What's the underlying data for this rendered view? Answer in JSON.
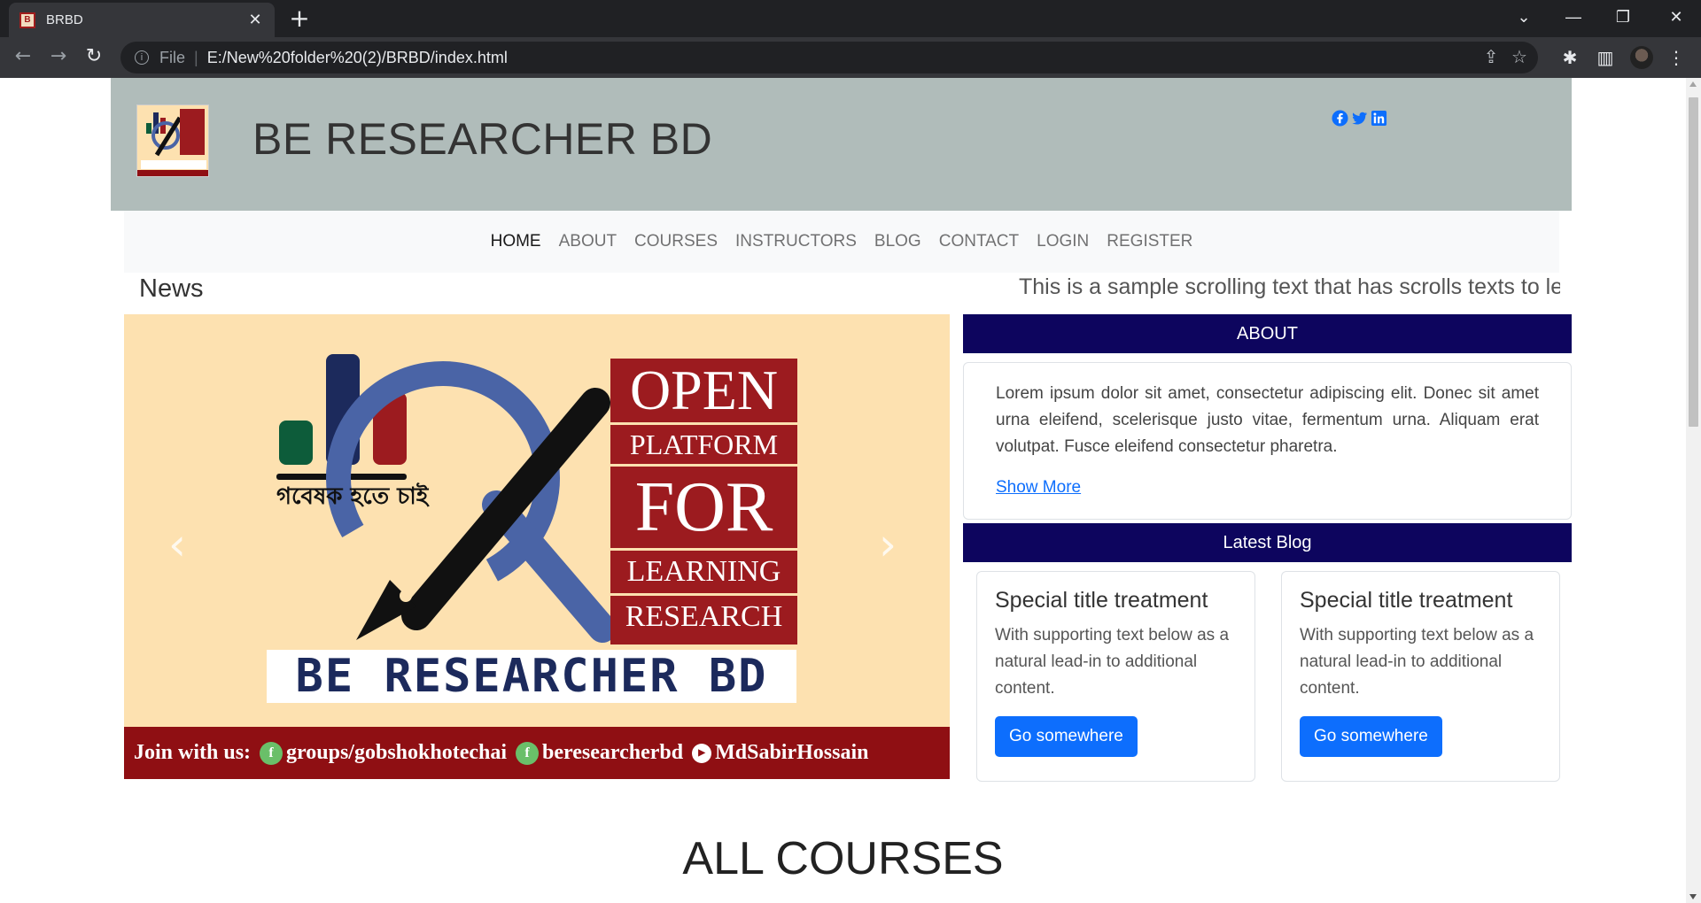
{
  "browser": {
    "tab_title": "BRBD",
    "tab_close": "✕",
    "new_tab": "+",
    "scheme": "File",
    "url": "E:/New%20folder%20(2)/BRBD/index.html",
    "icons": [
      "back-arrow-icon",
      "forward-arrow-icon",
      "reload-icon",
      "info-icon",
      "share-icon",
      "star-icon",
      "extensions-icon",
      "side-panel-icon",
      "profile-avatar",
      "menu-icon"
    ]
  },
  "header": {
    "site_title": "BE RESEARCHER BD",
    "social_icons": [
      "facebook-icon",
      "twitter-icon",
      "linkedin-icon"
    ],
    "colors": {
      "background": "#b0bcba",
      "social": "#0d6efd"
    }
  },
  "nav": {
    "items": [
      "HOME",
      "ABOUT",
      "COURSES",
      "INSTRUCTORS",
      "BLOG",
      "CONTACT",
      "LOGIN",
      "REGISTER"
    ],
    "active": "HOME"
  },
  "news": {
    "label": "News",
    "ticker": "This is a sample scrolling text that has scrolls texts to le"
  },
  "carousel": {
    "bangla_text": "গবেষক হতে চাই",
    "box_lines": [
      "OPEN",
      "PLATFORM",
      "FOR",
      "LEARNING",
      "RESEARCH"
    ],
    "brand": "BE RESEARCHER BD",
    "join_label": "Join with us:",
    "links": [
      "groups/gobshokhotechai",
      "beresearcherbd",
      "MdSabirHossain"
    ],
    "prev": "‹",
    "next": "›",
    "colors": {
      "background": "#fde1b0",
      "maroon": "#9c1b1f",
      "navy": "#1c2a5c",
      "blue_ring": "#4a64a6"
    }
  },
  "about": {
    "heading": "ABOUT",
    "body": "Lorem ipsum dolor sit amet, consectetur adipiscing elit. Donec sit amet urna eleifend, scelerisque justo vitae, fermentum urna. Aliquam erat volutpat. Fusce eleifend consectetur pharetra.",
    "link": "Show More"
  },
  "blog": {
    "heading": "Latest Blog",
    "cards": [
      {
        "title": "Special title treatment",
        "text": "With supporting text below as a natural lead-in to additional content.",
        "button": "Go somewhere"
      },
      {
        "title": "Special title treatment",
        "text": "With supporting text below as a natural lead-in to additional content.",
        "button": "Go somewhere"
      }
    ],
    "colors": {
      "heading_bg": "#0d055e",
      "button": "#0d6efd"
    }
  },
  "courses": {
    "heading": "ALL COURSES"
  }
}
